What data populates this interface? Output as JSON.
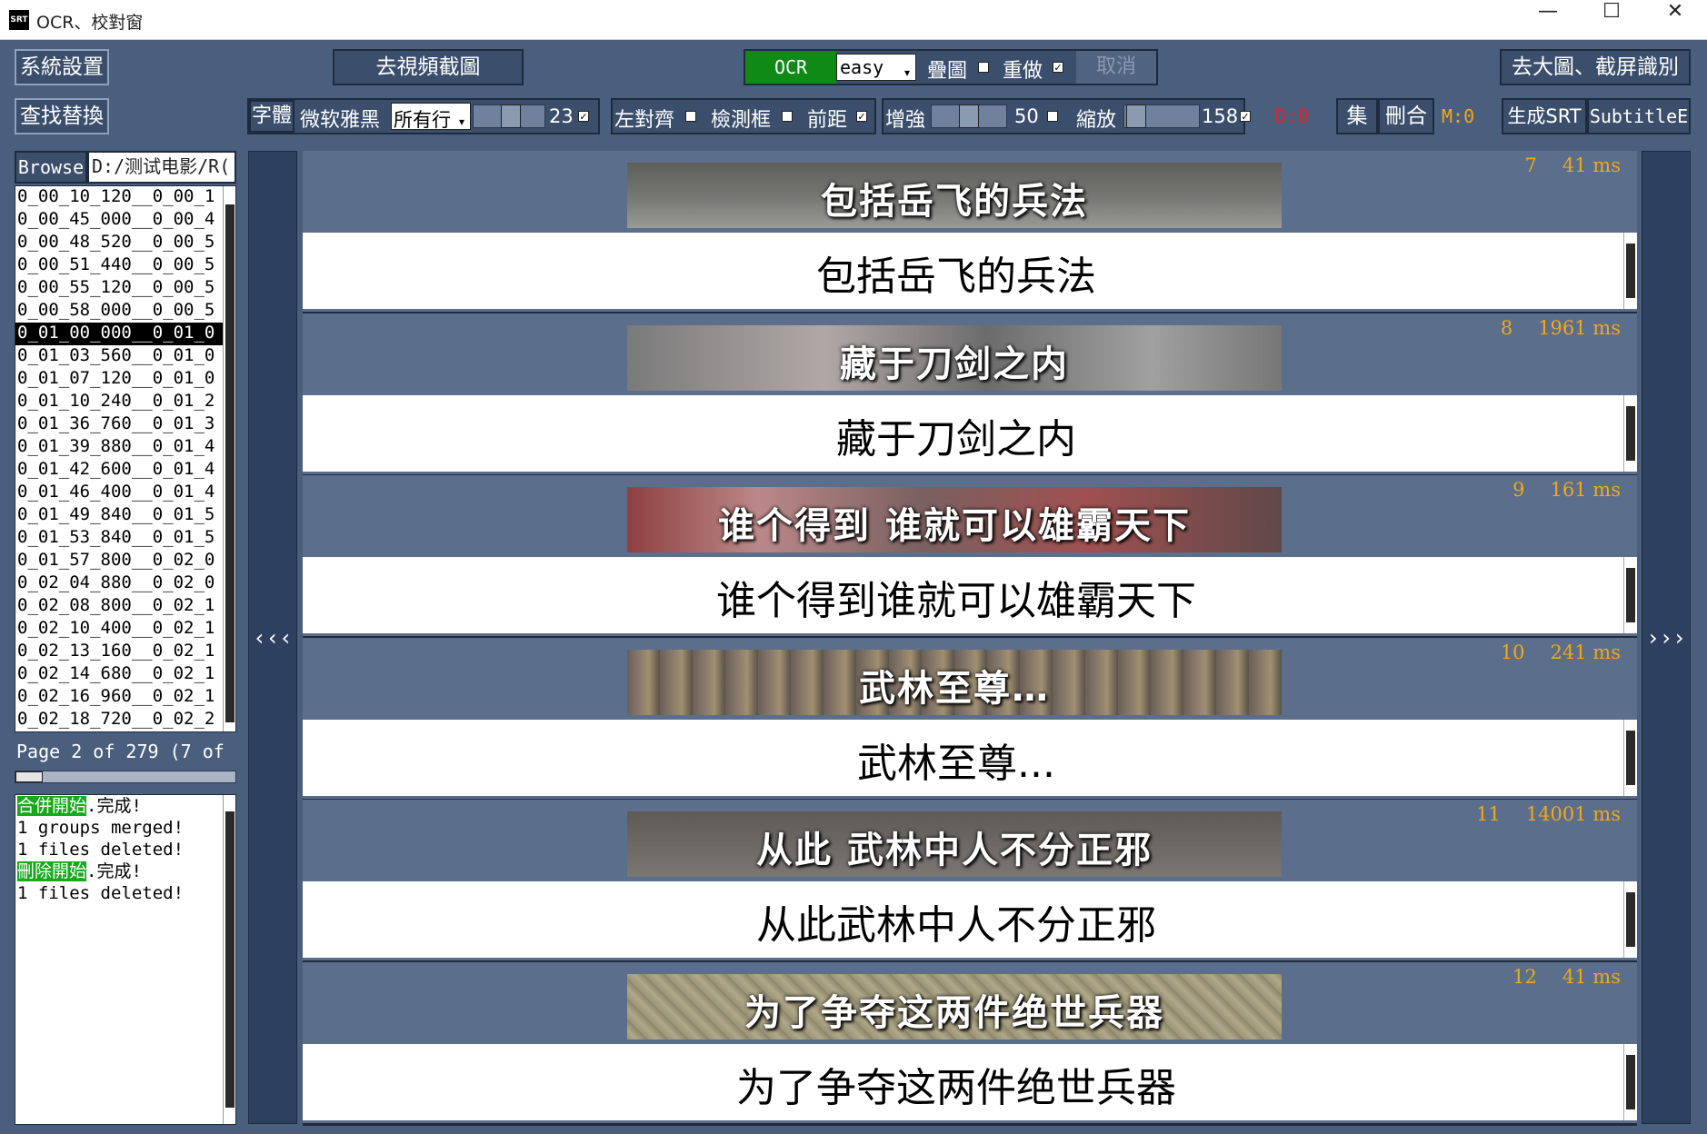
{
  "window": {
    "icon_text": "SRT",
    "title": "OCR、校對窗",
    "minimize": "—",
    "maximize": "☐",
    "close": "✕"
  },
  "toolbar1": {
    "settings": "系統設置",
    "goto_frames": "去視頻截圖",
    "ocr": "OCR",
    "engine": "easy",
    "overlay_label": "疊圖",
    "redo_label": "重做",
    "cancel": "取消",
    "bigimage": "去大圖、截屏識別"
  },
  "toolbar2": {
    "find_replace": "查找替換",
    "font_label": "字體",
    "font_name": "微软雅黑",
    "lines_value": "所有行",
    "font_size": "23",
    "align_left": "左對齊",
    "detect_box": "檢測框",
    "spacing": "前距",
    "enhance": "增強",
    "enhance_value": "50",
    "zoom": "縮放",
    "zoom_value": "158",
    "d_count": "D:0",
    "collect": "集",
    "delete_merge": "刪合",
    "m_count": "M:0",
    "generate_srt": "生成SRT",
    "subtitle_edit": "SubtitleE"
  },
  "left": {
    "browse": "Browse",
    "path": "D:/测试电影/R(",
    "files": [
      "0_00_10_120__0_00_1",
      "0_00_45_000__0_00_4",
      "0_00_48_520__0_00_5",
      "0_00_51_440__0_00_5",
      "0_00_55_120__0_00_5",
      "0_00_58_000__0_00_5",
      "0_01_00_000__0_01_0",
      "0_01_03_560__0_01_0",
      "0_01_07_120__0_01_0",
      "0_01_10_240__0_01_2",
      "0_01_36_760__0_01_3",
      "0_01_39_880__0_01_4",
      "0_01_42_600__0_01_4",
      "0_01_46_400__0_01_4",
      "0_01_49_840__0_01_5",
      "0_01_53_840__0_01_5",
      "0_01_57_800__0_02_0",
      "0_02_04_880__0_02_0",
      "0_02_08_800__0_02_1",
      "0_02_10_400__0_02_1",
      "0_02_13_160__0_02_1",
      "0_02_14_680__0_02_1",
      "0_02_16_960__0_02_1",
      "0_02_18_720__0_02_2"
    ],
    "page_info": "Page 2 of 279 (7 of",
    "log": {
      "l1_hl": "合併開始",
      "l1_rest": ".完成!",
      "l2": "1 groups merged!",
      "l3": "1 files deleted!",
      "l4_hl": "刪除開始",
      "l4_rest": ".完成!",
      "l5": "1 files deleted!"
    }
  },
  "nav": {
    "prev": "‹‹‹",
    "next": "›››"
  },
  "cards": [
    {
      "index": "7",
      "time": "41 ms",
      "image_text": "包括岳飞的兵法",
      "text": "包括岳飞的兵法"
    },
    {
      "index": "8",
      "time": "1961 ms",
      "image_text": "藏于刀剑之内",
      "text": "藏于刀剑之内"
    },
    {
      "index": "9",
      "time": "161 ms",
      "image_text": "谁个得到  谁就可以雄霸天下",
      "text": "谁个得到谁就可以雄霸天下"
    },
    {
      "index": "10",
      "time": "241 ms",
      "image_text": "武林至尊…",
      "text": "武林至尊..."
    },
    {
      "index": "11",
      "time": "14001 ms",
      "image_text": "从此  武林中人不分正邪",
      "text": "从此武林中人不分正邪"
    },
    {
      "index": "12",
      "time": "41 ms",
      "image_text": "为了争夺这两件绝世兵器",
      "text": "为了争夺这两件绝世兵器"
    }
  ],
  "colors": {
    "bg": "#4a5f7e",
    "ocr_green": "#0f8a14",
    "meta_orange": "#f2a818",
    "counter_red": "#e8202a"
  }
}
